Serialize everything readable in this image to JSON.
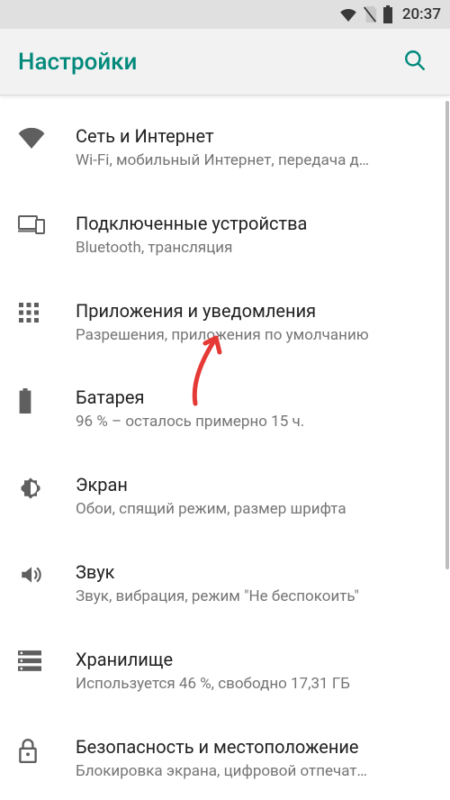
{
  "status": {
    "time": "20:37"
  },
  "header": {
    "title": "Настройки"
  },
  "items": [
    {
      "title": "Сеть и Интернет",
      "sub": "Wi-Fi, мобильный Интернет, передача д…"
    },
    {
      "title": "Подключенные устройства",
      "sub": "Bluetooth, трансляция"
    },
    {
      "title": "Приложения и уведомления",
      "sub": "Разрешения, приложения по умолчанию"
    },
    {
      "title": "Батарея",
      "sub": "96 % – осталось примерно 15 ч."
    },
    {
      "title": "Экран",
      "sub": "Обои, спящий режим, размер шрифта"
    },
    {
      "title": "Звук",
      "sub": "Звук, вибрация, режим \"Не беспокоить\""
    },
    {
      "title": "Хранилище",
      "sub": "Используется 46 %, свободно 17,31 ГБ"
    },
    {
      "title": "Безопасность и местоположение",
      "sub": "Блокировка экрана, цифровой отпечат…"
    }
  ]
}
